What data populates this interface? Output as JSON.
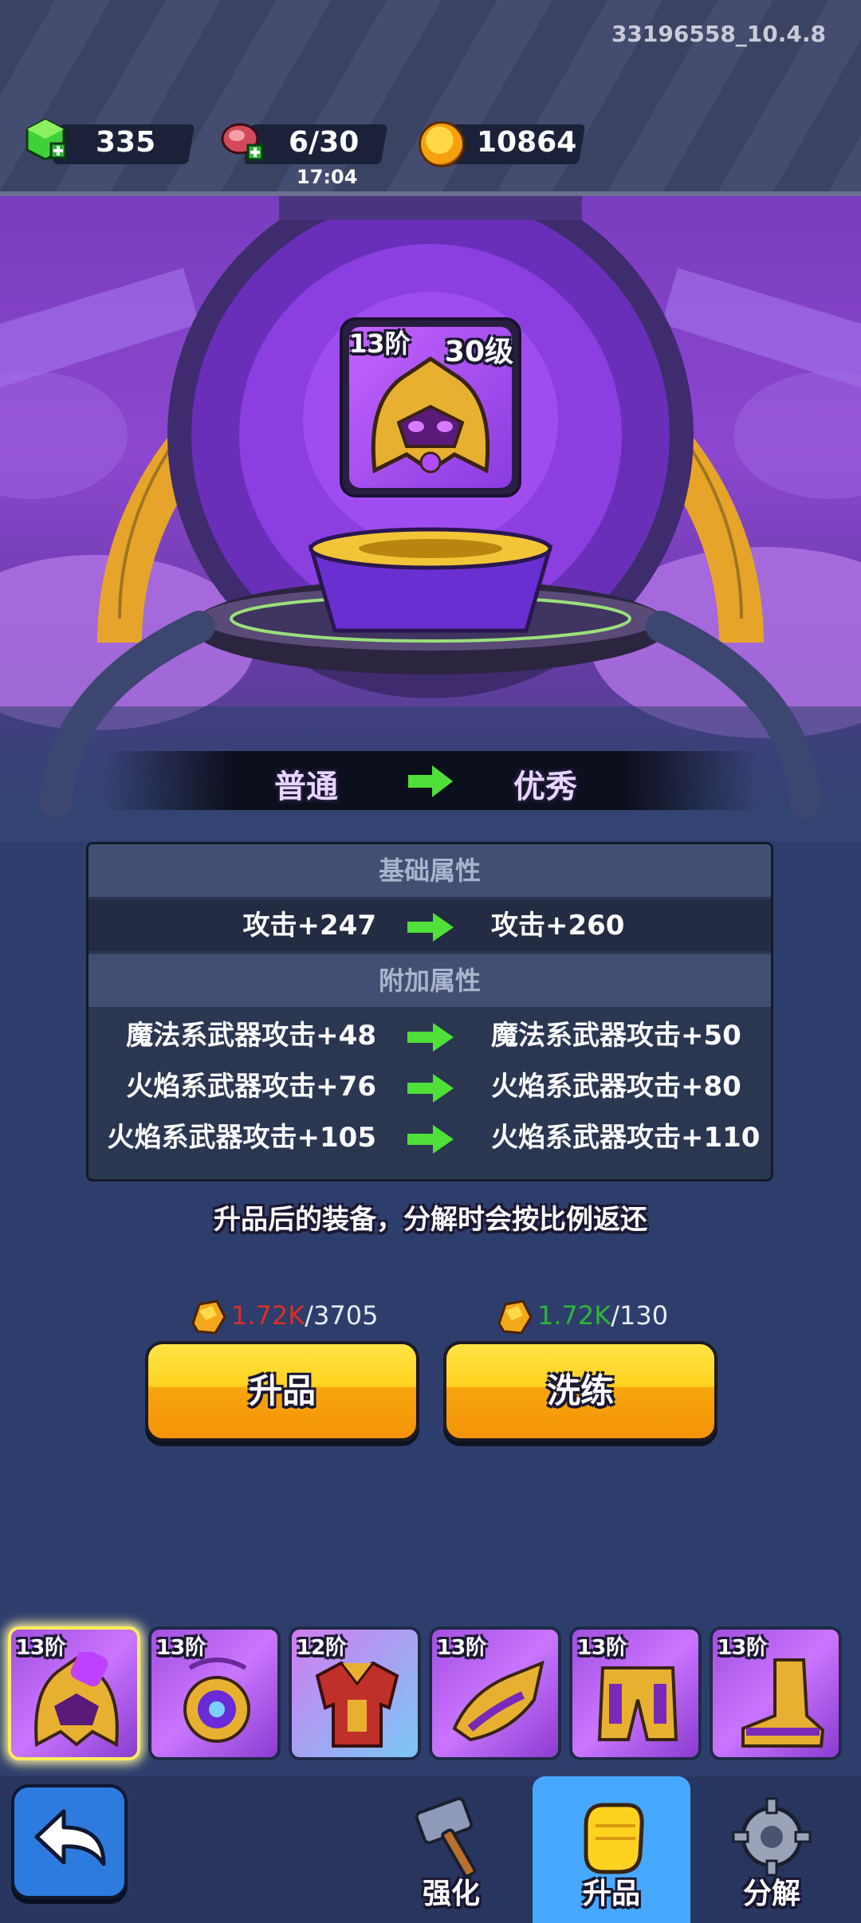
{
  "version": "33196558_10.4.8",
  "resources": {
    "gems": "335",
    "stamina": "6/30",
    "stamina_timer": "17:04",
    "gold": "10864"
  },
  "item": {
    "tier": "13阶",
    "level": "30级",
    "icon": "helmet-icon"
  },
  "quality": {
    "from": "普通",
    "to": "优秀"
  },
  "attributes": {
    "base_title": "基础属性",
    "base": [
      {
        "from": "攻击+247",
        "to": "攻击+260"
      }
    ],
    "extra_title": "附加属性",
    "extra": [
      {
        "from": "魔法系武器攻击+48",
        "to": "魔法系武器攻击+50"
      },
      {
        "from": "火焰系武器攻击+76",
        "to": "火焰系武器攻击+80"
      },
      {
        "from": "火焰系武器攻击+105",
        "to": "火焰系武器攻击+110"
      }
    ]
  },
  "note": "升品后的装备，分解时会按比例返还",
  "actions": {
    "upgrade": {
      "label": "升品",
      "have": "1.72K",
      "need": "/3705"
    },
    "reforge": {
      "label": "洗练",
      "have": "1.72K",
      "need": "/130"
    }
  },
  "slots": [
    {
      "tier": "13阶",
      "icon": "helmet-icon"
    },
    {
      "tier": "13阶",
      "icon": "amulet-icon"
    },
    {
      "tier": "12阶",
      "icon": "armor-icon"
    },
    {
      "tier": "13阶",
      "icon": "gauntlet-icon"
    },
    {
      "tier": "13阶",
      "icon": "leg-armor-icon"
    },
    {
      "tier": "13阶",
      "icon": "boots-icon"
    }
  ],
  "nav": {
    "enhance": "强化",
    "upgrade": "升品",
    "dismantle": "分解"
  },
  "colors": {
    "accent_yellow": "#ffd21f",
    "insufficient": "#d8302a",
    "sufficient": "#2fb53a",
    "panel": "#2b3651"
  }
}
